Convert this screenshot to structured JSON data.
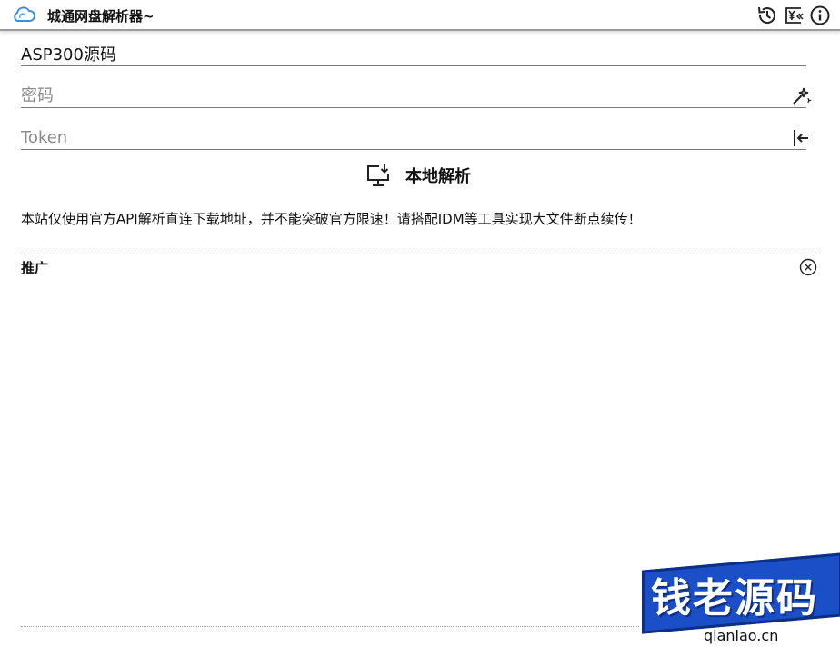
{
  "app": {
    "title": "城通网盘解析器~"
  },
  "toolbar": {
    "history_icon": "history-icon",
    "donate_icon": "yen-donate-icon",
    "info_icon": "info-icon"
  },
  "form": {
    "share_value": "ASP300源码",
    "password_placeholder": "密码",
    "password_icon": "magic-wand-icon",
    "token_placeholder": "Token",
    "token_icon": "login-arrow-icon"
  },
  "parse_button": {
    "label": "本地解析",
    "icon": "monitor-download-icon"
  },
  "notice": "本站仅使用官方API解析直连下载地址，并不能突破官方限速！请搭配IDM等工具实现大文件断点续传！",
  "promo": {
    "title": "推广",
    "close_icon": "close-circle-icon"
  },
  "watermark": {
    "text": "钱老源码",
    "url": "qianlao.cn"
  },
  "colors": {
    "accent_blue": "#1b4fc7",
    "app_icon": "#3a8ee6"
  }
}
